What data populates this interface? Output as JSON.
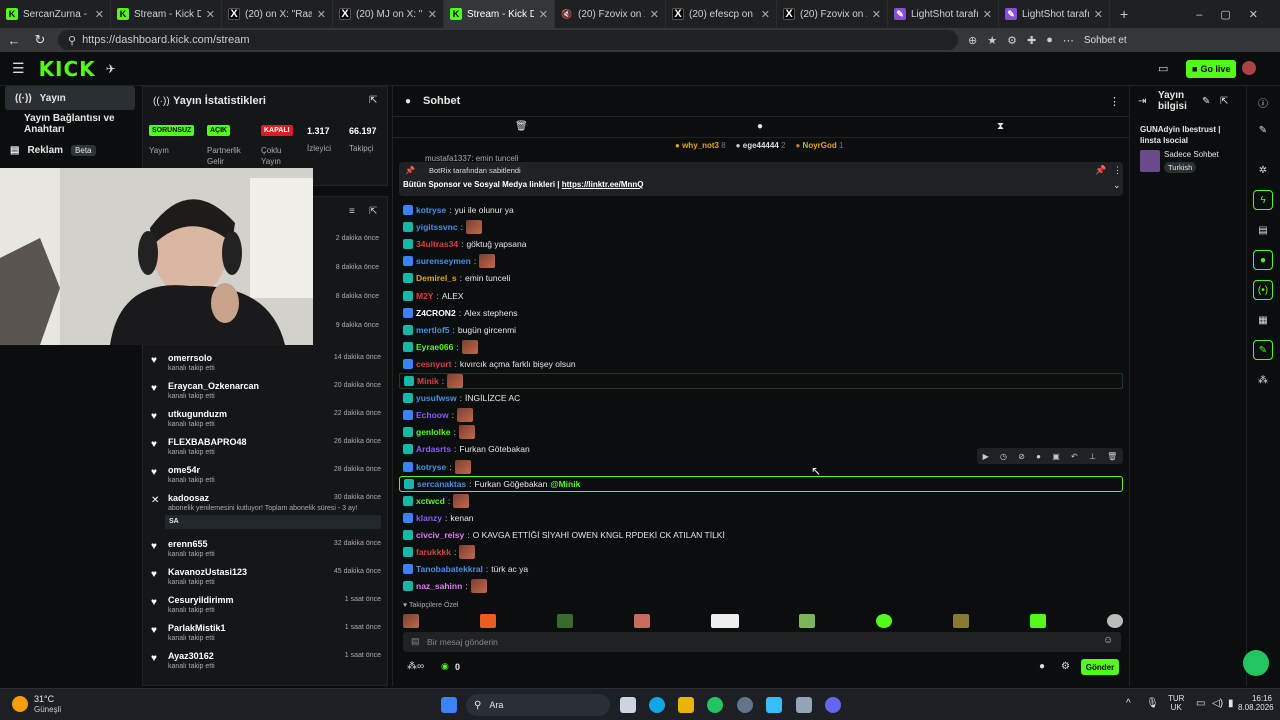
{
  "browser": {
    "tabs": [
      {
        "label": "SercanZurna - Watch",
        "icon": "kick",
        "active": false
      },
      {
        "label": "Stream - Kick Dashb",
        "icon": "kick",
        "active": false
      },
      {
        "label": "(20) on X: \"Raag",
        "icon": "x",
        "active": false
      },
      {
        "label": "(20) MJ on X: \"Selam",
        "icon": "x",
        "active": false
      },
      {
        "label": "Stream - Kick Dashb",
        "icon": "kick",
        "active": true
      },
      {
        "label": "(20) Fzovix on X",
        "icon": "mute",
        "active": false
      },
      {
        "label": "(20) efescp on X: \"G",
        "icon": "x",
        "active": false
      },
      {
        "label": "(20) Fzovix on X: \"k",
        "icon": "x",
        "active": false
      },
      {
        "label": "LightShot tarafından",
        "icon": "ls",
        "active": false
      },
      {
        "label": "LightShot tarafından",
        "icon": "ls",
        "active": false
      }
    ],
    "url": "https://dashboard.kick.com/stream",
    "profile_label": "Sohbet et"
  },
  "header": {
    "logo": "KICK",
    "go_live": "Go live"
  },
  "nav": {
    "items": [
      {
        "label": "Yayın",
        "selected": true
      },
      {
        "label": "Yayın Bağlantısı ve Anahtarı",
        "selected": false
      },
      {
        "label": "Reklam",
        "badge": "Beta",
        "selected": false
      }
    ]
  },
  "stats": {
    "title": "Yayın İstatistikleri",
    "badges": [
      "SORUNSUZ",
      "AÇIK",
      "KAPALI"
    ],
    "labels": [
      "Yayın",
      "Partnerlik Gelir",
      "Çoklu Yayın",
      "İzleyici",
      "Takipçi"
    ],
    "viewers": "1.317",
    "followers": "66.197"
  },
  "feed": {
    "top_times": [
      "2 dakika önce",
      "8 dakika önce",
      "8 dakika önce",
      "9 dakika önce"
    ],
    "rows": [
      {
        "name": "omerrsolo",
        "sub": "kanalı takip etti",
        "time": "14 dakika önce"
      },
      {
        "name": "Eraycan_Ozkenarcan",
        "sub": "kanalı takip etti",
        "time": "20 dakika önce"
      },
      {
        "name": "utkugunduzm",
        "sub": "kanalı takip etti",
        "time": "22 dakika önce"
      },
      {
        "name": "FLEXBABAPRO48",
        "sub": "kanalı takip etti",
        "time": "26 dakika önce"
      },
      {
        "name": "ome54r",
        "sub": "kanalı takip etti",
        "time": "28 dakika önce"
      },
      {
        "name": "kadoosaz",
        "sub": "abonelik yenilemesini kutluyor! Toplam abonelik süresi - 3 ay!",
        "time": "30 dakika önce",
        "note": "SA"
      },
      {
        "name": "erenn655",
        "sub": "kanalı takip etti",
        "time": "32 dakika önce"
      },
      {
        "name": "KavanozUstasi123",
        "sub": "kanalı takip etti",
        "time": "45 dakika önce"
      },
      {
        "name": "Cesuryildirimm",
        "sub": "kanalı takip etti",
        "time": "1 saat önce"
      },
      {
        "name": "ParlakMistik1",
        "sub": "kanalı takip etti",
        "time": "1 saat önce"
      },
      {
        "name": "Ayaz30162",
        "sub": "kanalı takip etti",
        "time": "1 saat önce"
      }
    ]
  },
  "chat": {
    "title": "Sohbet",
    "top_users": [
      {
        "name": "why_not3",
        "count": "8"
      },
      {
        "name": "ege44444",
        "count": "2"
      },
      {
        "name": "NoyrGod",
        "count": "1"
      }
    ],
    "prev_line": "mustafa1337: emin tunceli",
    "pinned_by": "BotRix tarafından sabitlendi",
    "pinned_text": "Bütün Sponsor ve Sosyal Medya linkleri |",
    "pinned_link": "https://linktr.ee/MnnQ",
    "messages": [
      {
        "user": "kotryse",
        "color": "#4a90e2",
        "text": "yui ile olunur ya",
        "emote": false
      },
      {
        "user": "yigitssvnc",
        "color": "#4a90e2",
        "text": "",
        "emote": true
      },
      {
        "user": "34ultras34",
        "color": "#e23c3c",
        "text": "göktuğ yapsana",
        "emote": false
      },
      {
        "user": "surenseymen",
        "color": "#4a90e2",
        "text": "",
        "emote": true
      },
      {
        "user": "Demirel_s",
        "color": "#e8a317",
        "text": "emin tunceli",
        "emote": false
      },
      {
        "user": "M2Y",
        "color": "#e23c3c",
        "text": "ALEX",
        "emote": false
      },
      {
        "user": "Z4CRON2",
        "color": "#ffffff",
        "text": "Alex stephens",
        "emote": false
      },
      {
        "user": "mertlof5",
        "color": "#4a90e2",
        "text": "bugün gircenmi",
        "emote": false
      },
      {
        "user": "Eyrae066",
        "color": "#53fc18",
        "text": "",
        "emote": true
      },
      {
        "user": "cesnyurt",
        "color": "#e23c3c",
        "text": "kıvırcık açma farklı bişey olsun",
        "emote": false
      },
      {
        "user": "Minik",
        "color": "#e23c3c",
        "text": "",
        "emote": true
      },
      {
        "user": "yusufwsw",
        "color": "#4a90e2",
        "text": "İNGİLİZCE AC",
        "emote": false
      },
      {
        "user": "Echoow",
        "color": "#8a5cf6",
        "text": "",
        "emote": true
      },
      {
        "user": "genlolke",
        "color": "#53fc18",
        "text": "",
        "emote": true
      },
      {
        "user": "Ardasrts",
        "color": "#8a5cf6",
        "text": "Furkan Götebakan",
        "emote": false
      },
      {
        "user": "kotryse",
        "color": "#4a90e2",
        "text": "",
        "emote": true
      },
      {
        "user": "sercanaktas",
        "color": "#4a90e2",
        "text": "Furkan Göğebakan",
        "mention": "@Minik",
        "emote": false
      },
      {
        "user": "xctwcd",
        "color": "#53fc18",
        "text": "",
        "emote": true
      },
      {
        "user": "klanzy",
        "color": "#8a5cf6",
        "text": "kenan",
        "emote": false
      },
      {
        "user": "civciv_reisy",
        "color": "#e879f9",
        "text": "O KAVGA ETTİĞİ SİYAHİ OWEN KNGL RPDEKİ CK ATILAN TİLKİ",
        "emote": false
      },
      {
        "user": "farukkkk",
        "color": "#e23c3c",
        "text": "",
        "emote": true
      },
      {
        "user": "Tanobabatekkral",
        "color": "#4a90e2",
        "text": "türk ac ya",
        "emote": false
      },
      {
        "user": "naz_sahinn",
        "color": "#e879f9",
        "text": "",
        "emote": true
      }
    ],
    "emote_section": "Takipçilere Özel",
    "input_placeholder": "Bir mesaj gönderin",
    "points": "0",
    "send_label": "Gönder"
  },
  "stream_info": {
    "title": "Yayın bilgisi",
    "stream_title": "GUNAdyin Ibestrust | Iinsta Isocial",
    "chat_mode": "Sadece Sohbet",
    "language": "Turkish"
  },
  "taskbar": {
    "weather_temp": "31°C",
    "weather_desc": "Güneşli",
    "search": "Ara",
    "lang": "TUR",
    "region": "UK",
    "time": "16:16",
    "date": "8.08.2026"
  },
  "colors": {
    "accent": "#53fc18",
    "bg": "#0b0e0f",
    "panel": "#141719"
  }
}
